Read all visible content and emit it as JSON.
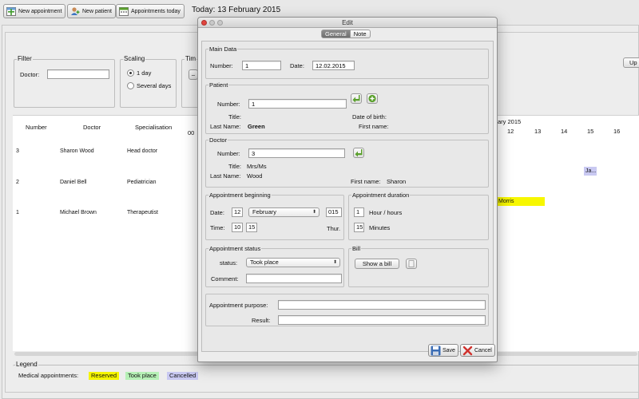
{
  "toolbar": {
    "new_appointment": "New appointment",
    "new_patient": "New patient",
    "appointments_today": "Appointments today",
    "today": "Today: 13 February 2015"
  },
  "filter": {
    "title": "Filter",
    "doctor_label": "Doctor:",
    "doctor_value": ""
  },
  "scaling": {
    "title": "Scaling",
    "opt_1day": "1 day",
    "opt_several": "Several days",
    "selected": "1 day"
  },
  "time_title_partial": "Tim",
  "update_button_partial": "Up",
  "table": {
    "headers": [
      "Number",
      "Doctor",
      "Specialisation"
    ],
    "hour_first": "00",
    "rows": [
      {
        "number": "3",
        "doctor": "Sharon Wood",
        "spec": "Head doctor"
      },
      {
        "number": "2",
        "doctor": "Daniel Bell",
        "spec": "Pediatrician"
      },
      {
        "number": "1",
        "doctor": "Michael Brown",
        "spec": "Therapeutist"
      }
    ],
    "date_header_partial": "ary 2015",
    "hours": [
      "12",
      "13",
      "14",
      "15",
      "16"
    ],
    "appts": [
      {
        "text": "Ja...",
        "color": "#c9c9f2"
      },
      {
        "text": "Morris",
        "color": "#f7f700"
      }
    ]
  },
  "legend": {
    "title": "Legend",
    "label": "Medical appointments:",
    "reserved": "Reserved",
    "took_place": "Took place",
    "cancelled": "Cancelled",
    "reserved_color": "#f5f500",
    "took_color": "#b6f0b6",
    "cancelled_color": "#c9c9f2"
  },
  "dialog": {
    "title": "Edit",
    "tabs": [
      "General",
      "Note"
    ],
    "main": {
      "title": "Main Data",
      "number_label": "Number:",
      "number_value": "1",
      "date_label": "Date:",
      "date_value": "12.02.2015"
    },
    "patient": {
      "title": "Patient",
      "number_label": "Number:",
      "number_value": "1",
      "title_label": "Title:",
      "dob_label": "Date of birth:",
      "lastname_label": "Last Name:",
      "lastname_value": "Green",
      "firstname_label": "First name:"
    },
    "doctor": {
      "title": "Doctor",
      "number_label": "Number:",
      "number_value": "3",
      "title_label": "Title:",
      "title_value": "Mrs/Ms",
      "lastname_label": "Last Name:",
      "lastname_value": "Wood",
      "firstname_label": "First name:",
      "firstname_value": "Sharon"
    },
    "beginning": {
      "title": "Appointment beginning",
      "date_label": "Date:",
      "day": "12",
      "month": "February",
      "year": "015",
      "time_label": "Time:",
      "hour": "10",
      "minute": "15",
      "weekday": "Thur."
    },
    "duration": {
      "title": "Appointment duration",
      "hours": "1",
      "hours_label": "Hour / hours",
      "minutes": "15",
      "minutes_label": "Minutes"
    },
    "status": {
      "title": "Appointment status",
      "status_label": "status:",
      "status_value": "Took place",
      "comment_label": "Comment:",
      "comment_value": ""
    },
    "bill": {
      "title": "Bill",
      "show_bill": "Show a bill"
    },
    "purpose": {
      "purpose_label": "Appointment purpose:",
      "purpose_value": "",
      "result_label": "Result:",
      "result_value": ""
    },
    "save": "Save",
    "cancel": "Cancel"
  },
  "colors": {
    "accent_green": "#5aa02c",
    "close_red": "#e0443e",
    "minimize": "#c9c9c9",
    "save_blue": "#3b6db5",
    "cancel_red": "#d0312d"
  }
}
